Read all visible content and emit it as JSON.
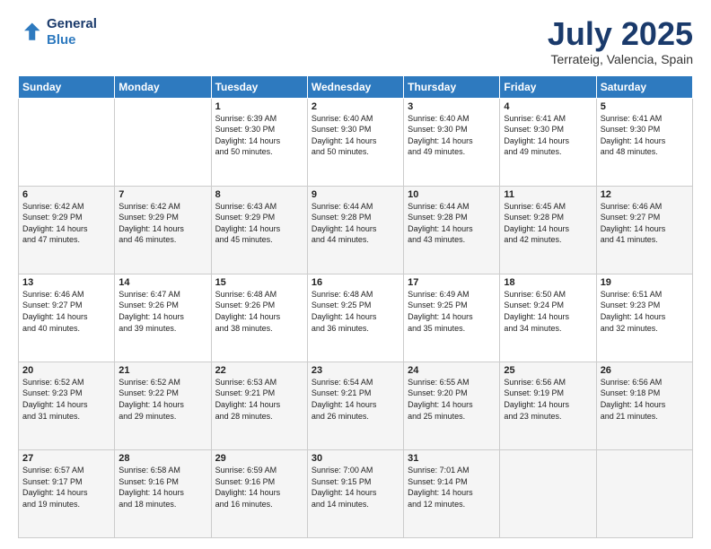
{
  "logo": {
    "line1": "General",
    "line2": "Blue"
  },
  "title": "July 2025",
  "subtitle": "Terrateig, Valencia, Spain",
  "days_header": [
    "Sunday",
    "Monday",
    "Tuesday",
    "Wednesday",
    "Thursday",
    "Friday",
    "Saturday"
  ],
  "weeks": [
    [
      {
        "day": "",
        "info": ""
      },
      {
        "day": "",
        "info": ""
      },
      {
        "day": "1",
        "info": "Sunrise: 6:39 AM\nSunset: 9:30 PM\nDaylight: 14 hours\nand 50 minutes."
      },
      {
        "day": "2",
        "info": "Sunrise: 6:40 AM\nSunset: 9:30 PM\nDaylight: 14 hours\nand 50 minutes."
      },
      {
        "day": "3",
        "info": "Sunrise: 6:40 AM\nSunset: 9:30 PM\nDaylight: 14 hours\nand 49 minutes."
      },
      {
        "day": "4",
        "info": "Sunrise: 6:41 AM\nSunset: 9:30 PM\nDaylight: 14 hours\nand 49 minutes."
      },
      {
        "day": "5",
        "info": "Sunrise: 6:41 AM\nSunset: 9:30 PM\nDaylight: 14 hours\nand 48 minutes."
      }
    ],
    [
      {
        "day": "6",
        "info": "Sunrise: 6:42 AM\nSunset: 9:29 PM\nDaylight: 14 hours\nand 47 minutes."
      },
      {
        "day": "7",
        "info": "Sunrise: 6:42 AM\nSunset: 9:29 PM\nDaylight: 14 hours\nand 46 minutes."
      },
      {
        "day": "8",
        "info": "Sunrise: 6:43 AM\nSunset: 9:29 PM\nDaylight: 14 hours\nand 45 minutes."
      },
      {
        "day": "9",
        "info": "Sunrise: 6:44 AM\nSunset: 9:28 PM\nDaylight: 14 hours\nand 44 minutes."
      },
      {
        "day": "10",
        "info": "Sunrise: 6:44 AM\nSunset: 9:28 PM\nDaylight: 14 hours\nand 43 minutes."
      },
      {
        "day": "11",
        "info": "Sunrise: 6:45 AM\nSunset: 9:28 PM\nDaylight: 14 hours\nand 42 minutes."
      },
      {
        "day": "12",
        "info": "Sunrise: 6:46 AM\nSunset: 9:27 PM\nDaylight: 14 hours\nand 41 minutes."
      }
    ],
    [
      {
        "day": "13",
        "info": "Sunrise: 6:46 AM\nSunset: 9:27 PM\nDaylight: 14 hours\nand 40 minutes."
      },
      {
        "day": "14",
        "info": "Sunrise: 6:47 AM\nSunset: 9:26 PM\nDaylight: 14 hours\nand 39 minutes."
      },
      {
        "day": "15",
        "info": "Sunrise: 6:48 AM\nSunset: 9:26 PM\nDaylight: 14 hours\nand 38 minutes."
      },
      {
        "day": "16",
        "info": "Sunrise: 6:48 AM\nSunset: 9:25 PM\nDaylight: 14 hours\nand 36 minutes."
      },
      {
        "day": "17",
        "info": "Sunrise: 6:49 AM\nSunset: 9:25 PM\nDaylight: 14 hours\nand 35 minutes."
      },
      {
        "day": "18",
        "info": "Sunrise: 6:50 AM\nSunset: 9:24 PM\nDaylight: 14 hours\nand 34 minutes."
      },
      {
        "day": "19",
        "info": "Sunrise: 6:51 AM\nSunset: 9:23 PM\nDaylight: 14 hours\nand 32 minutes."
      }
    ],
    [
      {
        "day": "20",
        "info": "Sunrise: 6:52 AM\nSunset: 9:23 PM\nDaylight: 14 hours\nand 31 minutes."
      },
      {
        "day": "21",
        "info": "Sunrise: 6:52 AM\nSunset: 9:22 PM\nDaylight: 14 hours\nand 29 minutes."
      },
      {
        "day": "22",
        "info": "Sunrise: 6:53 AM\nSunset: 9:21 PM\nDaylight: 14 hours\nand 28 minutes."
      },
      {
        "day": "23",
        "info": "Sunrise: 6:54 AM\nSunset: 9:21 PM\nDaylight: 14 hours\nand 26 minutes."
      },
      {
        "day": "24",
        "info": "Sunrise: 6:55 AM\nSunset: 9:20 PM\nDaylight: 14 hours\nand 25 minutes."
      },
      {
        "day": "25",
        "info": "Sunrise: 6:56 AM\nSunset: 9:19 PM\nDaylight: 14 hours\nand 23 minutes."
      },
      {
        "day": "26",
        "info": "Sunrise: 6:56 AM\nSunset: 9:18 PM\nDaylight: 14 hours\nand 21 minutes."
      }
    ],
    [
      {
        "day": "27",
        "info": "Sunrise: 6:57 AM\nSunset: 9:17 PM\nDaylight: 14 hours\nand 19 minutes."
      },
      {
        "day": "28",
        "info": "Sunrise: 6:58 AM\nSunset: 9:16 PM\nDaylight: 14 hours\nand 18 minutes."
      },
      {
        "day": "29",
        "info": "Sunrise: 6:59 AM\nSunset: 9:16 PM\nDaylight: 14 hours\nand 16 minutes."
      },
      {
        "day": "30",
        "info": "Sunrise: 7:00 AM\nSunset: 9:15 PM\nDaylight: 14 hours\nand 14 minutes."
      },
      {
        "day": "31",
        "info": "Sunrise: 7:01 AM\nSunset: 9:14 PM\nDaylight: 14 hours\nand 12 minutes."
      },
      {
        "day": "",
        "info": ""
      },
      {
        "day": "",
        "info": ""
      }
    ]
  ]
}
